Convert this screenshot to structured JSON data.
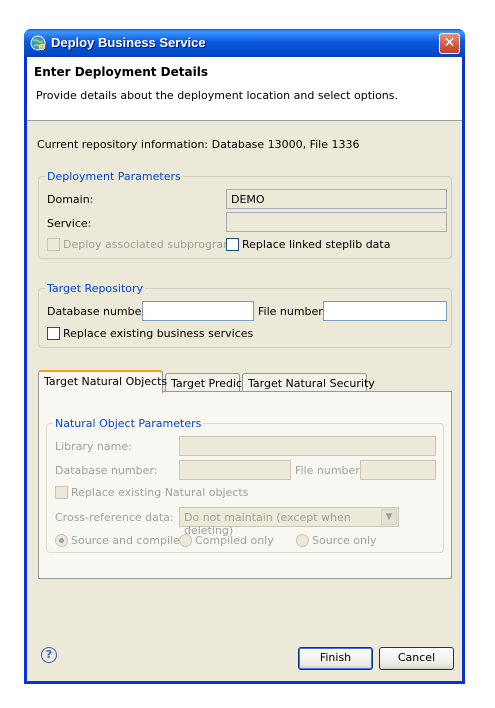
{
  "window": {
    "title": "Deploy Business Service",
    "close_glyph": "✕"
  },
  "header": {
    "title": "Enter Deployment Details",
    "description": "Provide details about the deployment location and select options."
  },
  "repository_info": "Current repository information: Database 13000, File 1336",
  "deployment_parameters": {
    "legend": "Deployment Parameters",
    "domain_label": "Domain:",
    "domain_value": "DEMO",
    "service_label": "Service:",
    "service_value": "",
    "deploy_subprograms_label": "Deploy associated subprograms",
    "replace_steplib_label": "Replace linked steplib data"
  },
  "target_repository": {
    "legend": "Target Repository",
    "database_label": "Database number:",
    "database_value": "",
    "file_label": "File number:",
    "file_value": "",
    "replace_services_label": "Replace existing business services"
  },
  "tabs": [
    {
      "label": "Target Natural Objects",
      "active": true
    },
    {
      "label": "Target Predict",
      "active": false
    },
    {
      "label": "Target Natural Security",
      "active": false
    }
  ],
  "natural_object_parameters": {
    "legend": "Natural Object Parameters",
    "library_label": "Library name:",
    "library_value": "",
    "database_label": "Database number:",
    "database_value": "",
    "file_label": "File number:",
    "file_value": "",
    "replace_objects_label": "Replace existing Natural objects",
    "xref_label": "Cross-reference data:",
    "xref_value": "Do not maintain (except when deleting)",
    "radio_source_compiled": "Source and compiled",
    "radio_compiled_only": "Compiled only",
    "radio_source_only": "Source only"
  },
  "footer": {
    "help_glyph": "?",
    "finish_label": "Finish",
    "cancel_label": "Cancel"
  },
  "icons": {
    "title_icon": "service-globe-icon",
    "help_icon": "help-icon",
    "dropdown_icon": "chevron-down-icon"
  },
  "colors": {
    "titlebar": "#0a5adf",
    "window_bg": "#ece9d8",
    "legend_text": "#0046d5",
    "active_tab_accent": "#f2a01c",
    "close_button": "#d4563c"
  }
}
